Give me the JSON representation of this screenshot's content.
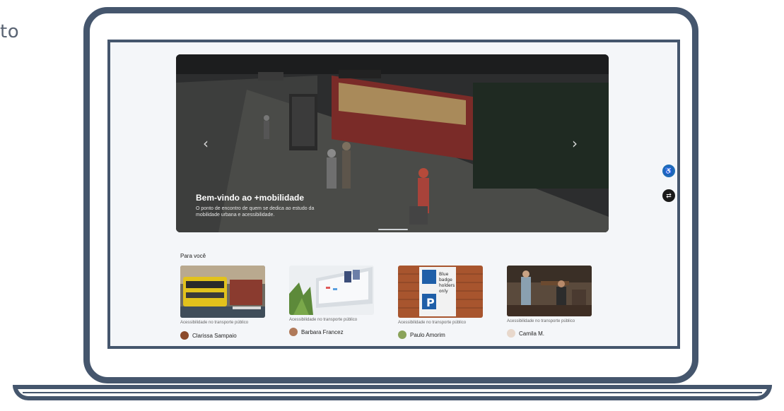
{
  "page": {
    "side_text": "to"
  },
  "hero": {
    "title": "Bem-vindo ao +mobilidade",
    "subtitle": "O ponto de encontro de quem se dedica ao estudo da mobilidade urbana e acessibilidade.",
    "prev_icon": "chevron-left-icon",
    "next_icon": "chevron-right-icon"
  },
  "section": {
    "title": "Para você"
  },
  "cards": [
    {
      "category": "Acessibilidade no transporte público",
      "author": "Clarissa Sampaio",
      "avatar_color": "#8b4a2b"
    },
    {
      "category": "Acessibilidade no transporte público",
      "author": "Barbara Francez",
      "avatar_color": "#b07a5a"
    },
    {
      "category": "Acessibilidade no transporte público",
      "author": "Paulo Amorim",
      "avatar_color": "#8aa35a"
    },
    {
      "category": "Acessibilidade no transporte público",
      "author": "Camila M.",
      "avatar_color": "#e8d8cc"
    }
  ],
  "floating": {
    "accessibility_icon": "accessibility-icon",
    "translate_icon": "translate-icon"
  },
  "colors": {
    "frame": "#45566d",
    "screen_bg": "#f4f6f9",
    "fab_blue": "#1e6bb8"
  }
}
